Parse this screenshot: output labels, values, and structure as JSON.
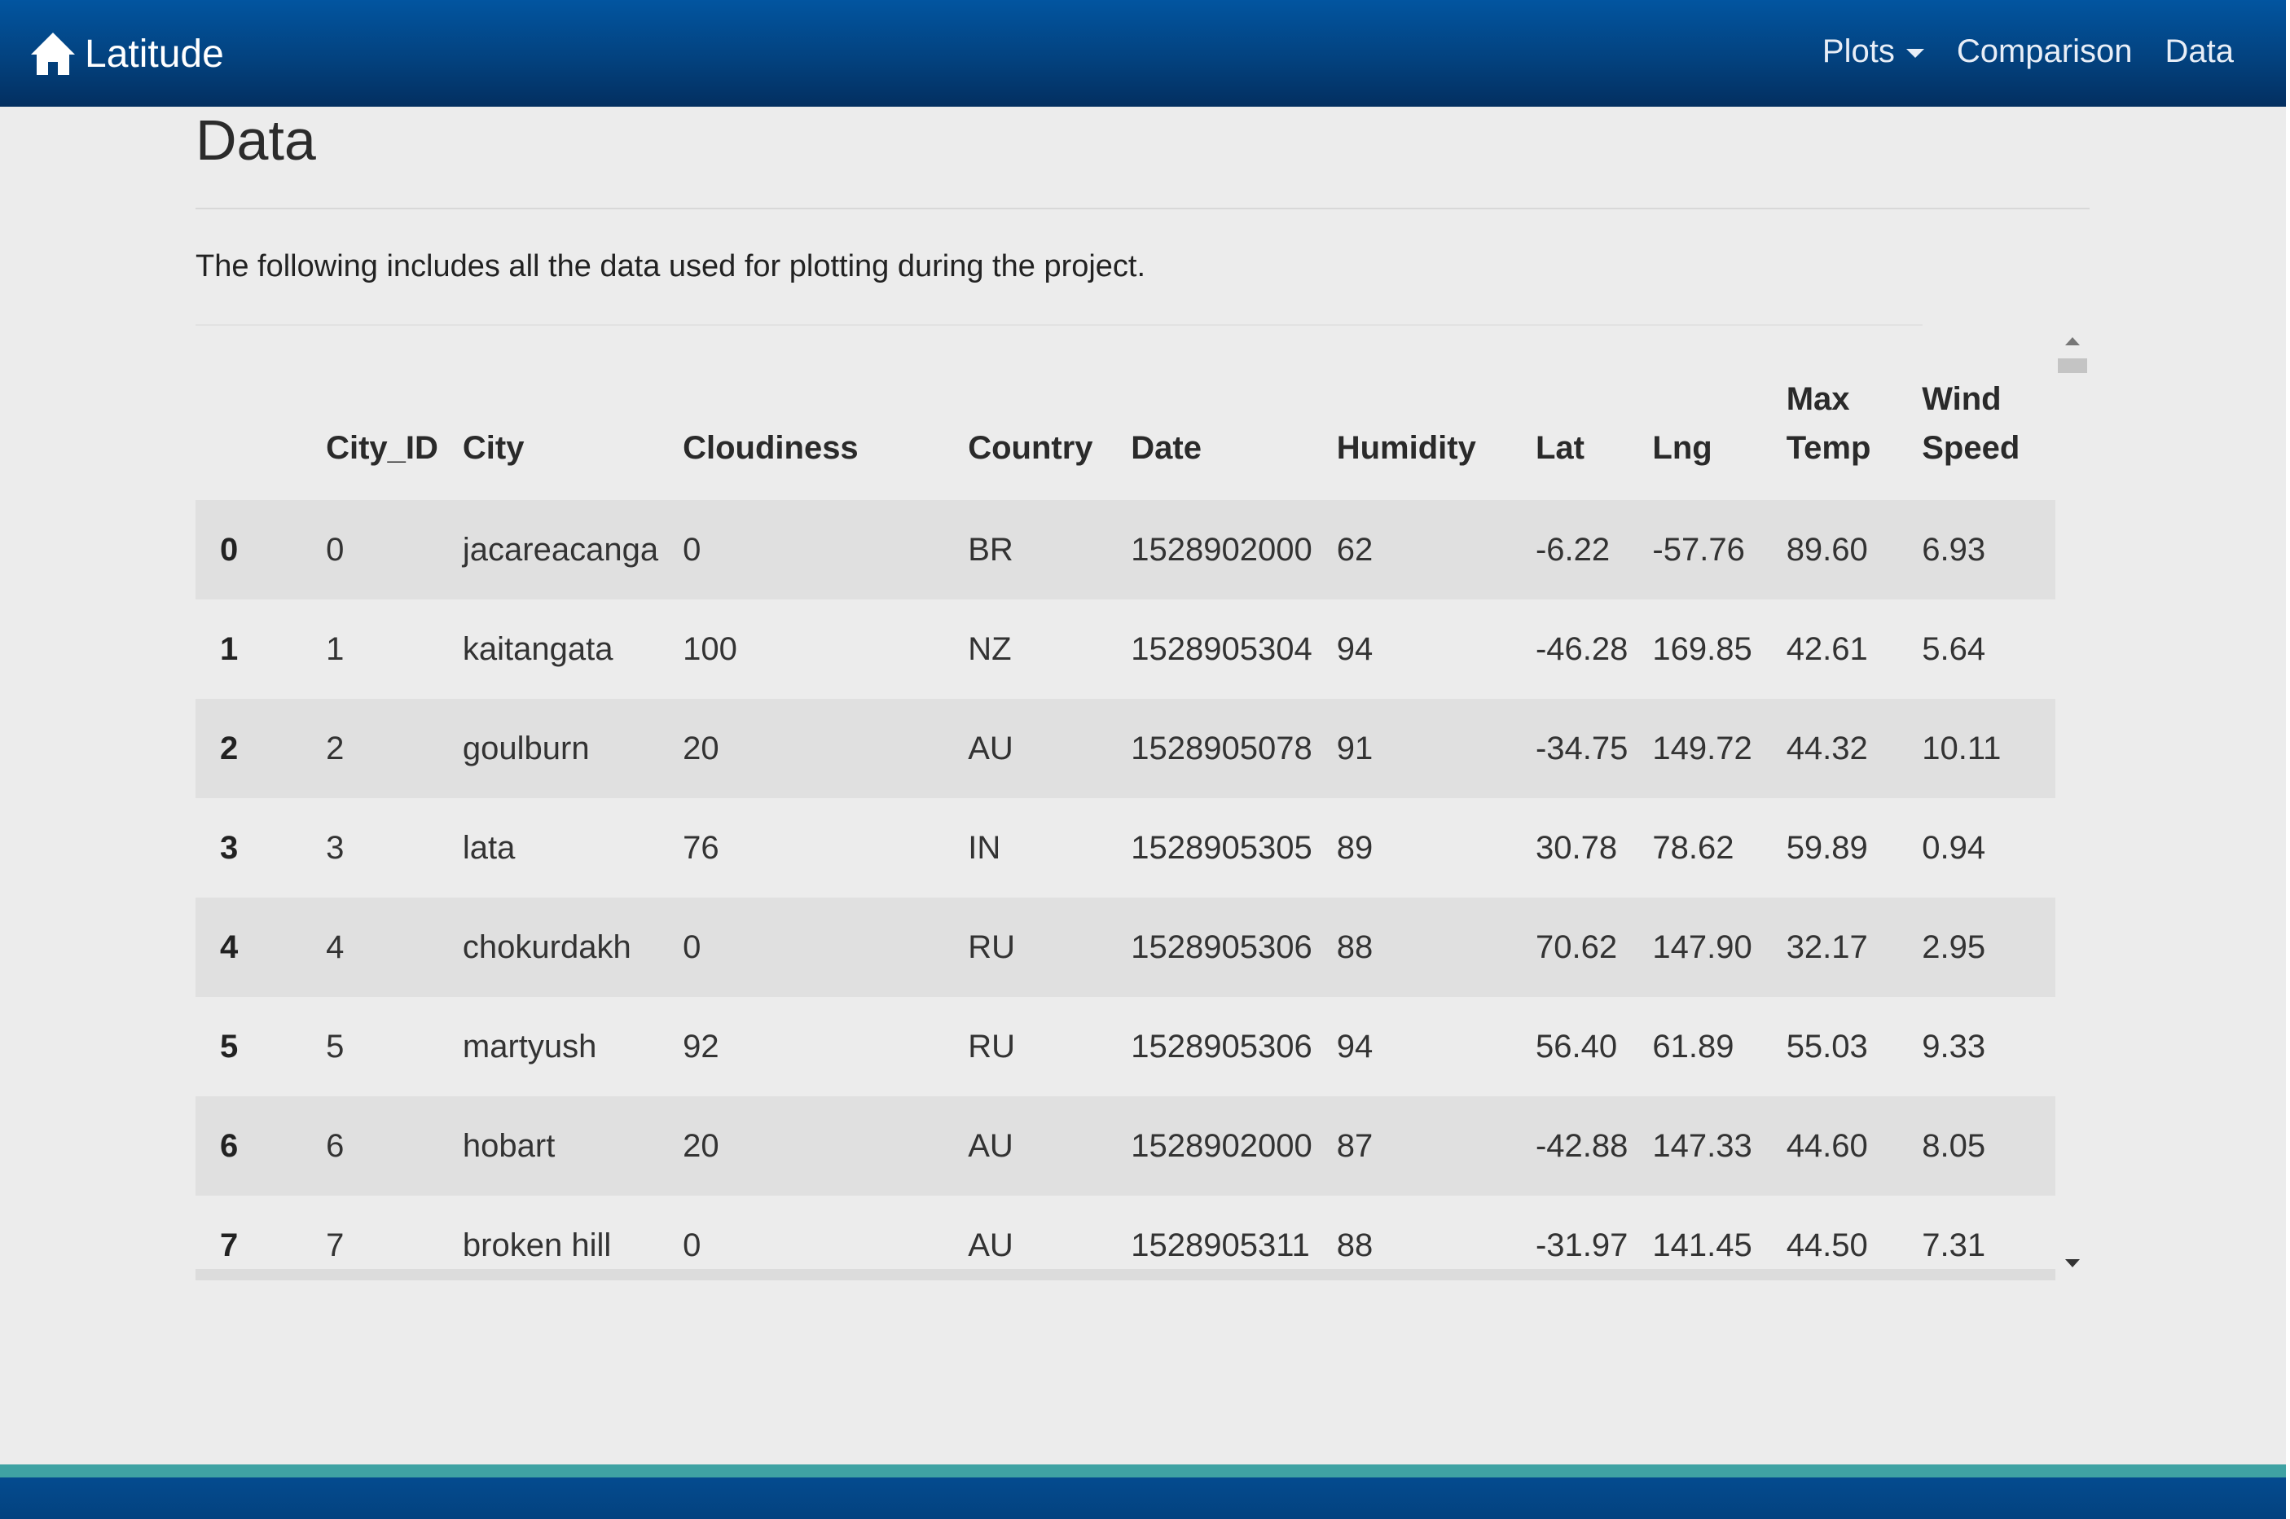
{
  "navbar": {
    "brand": "Latitude",
    "icon": "home-icon",
    "links": [
      "Plots",
      "Comparison",
      "Data"
    ]
  },
  "page": {
    "title": "Data",
    "lead": "The following includes all the data used for plotting during the project."
  },
  "table": {
    "headers": [
      "",
      "City_ID",
      "City",
      "Cloudiness",
      "Country",
      "Date",
      "Humidity",
      "Lat",
      "Lng",
      "Max Temp",
      "Wind Speed"
    ],
    "header_lines": {
      "max_temp": [
        "Max",
        "Temp"
      ],
      "wind_speed": [
        "Wind",
        "Speed"
      ]
    },
    "rows": [
      [
        "0",
        "0",
        "jacareacanga",
        "0",
        "BR",
        "1528902000",
        "62",
        "-6.22",
        "-57.76",
        "89.60",
        "6.93"
      ],
      [
        "1",
        "1",
        "kaitangata",
        "100",
        "NZ",
        "1528905304",
        "94",
        "-46.28",
        "169.85",
        "42.61",
        "5.64"
      ],
      [
        "2",
        "2",
        "goulburn",
        "20",
        "AU",
        "1528905078",
        "91",
        "-34.75",
        "149.72",
        "44.32",
        "10.11"
      ],
      [
        "3",
        "3",
        "lata",
        "76",
        "IN",
        "1528905305",
        "89",
        "30.78",
        "78.62",
        "59.89",
        "0.94"
      ],
      [
        "4",
        "4",
        "chokurdakh",
        "0",
        "RU",
        "1528905306",
        "88",
        "70.62",
        "147.90",
        "32.17",
        "2.95"
      ],
      [
        "5",
        "5",
        "martyush",
        "92",
        "RU",
        "1528905306",
        "94",
        "56.40",
        "61.89",
        "55.03",
        "9.33"
      ],
      [
        "6",
        "6",
        "hobart",
        "20",
        "AU",
        "1528902000",
        "87",
        "-42.88",
        "147.33",
        "44.60",
        "8.05"
      ],
      [
        "7",
        "7",
        "broken hill",
        "0",
        "AU",
        "1528905311",
        "88",
        "-31.97",
        "141.45",
        "44.50",
        "7.31"
      ]
    ]
  },
  "colors": {
    "navbar": "#03427f",
    "footer_accent": "#3fa2a3",
    "background": "#ececec",
    "stripe": "#e0e0e0"
  }
}
